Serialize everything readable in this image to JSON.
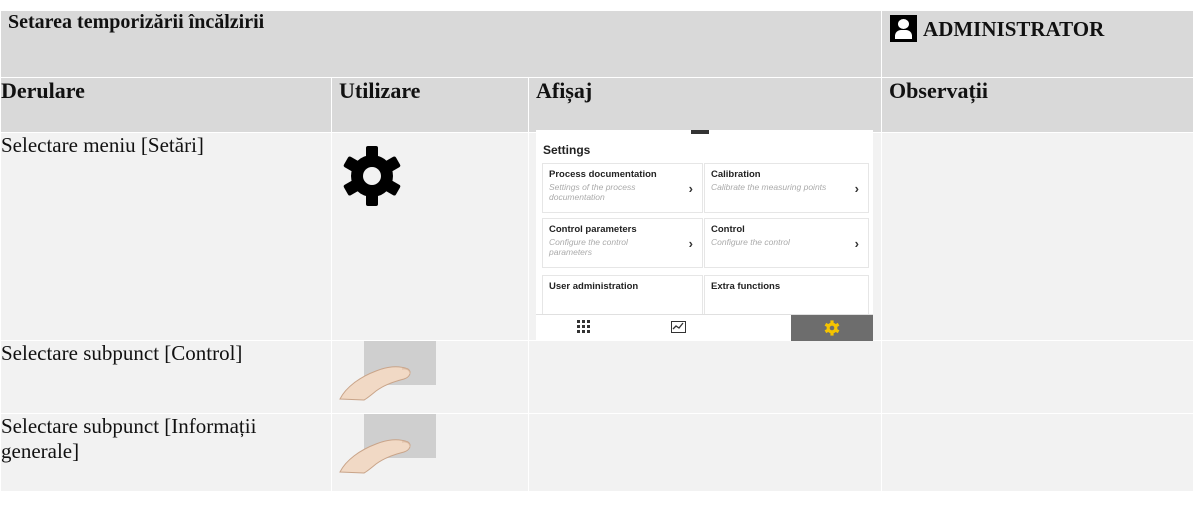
{
  "document": {
    "title": "Setarea temporizării încălzirii",
    "role": "ADMINISTRATOR",
    "columns": [
      "Derulare",
      "Utilizare",
      "Afișaj",
      "Observații"
    ],
    "rows": [
      {
        "step": "Selectare meniu [Setări]",
        "usage_icon": "gear-icon"
      },
      {
        "step": "Selectare subpunct [Control]",
        "usage_icon": "finger-tap-icon"
      },
      {
        "step": "Selectare subpunct [Informații generale]",
        "usage_icon": "finger-tap-icon"
      }
    ]
  },
  "screen": {
    "title": "Settings",
    "tiles": [
      {
        "name": "Process documentation",
        "desc": "Settings of the process documentation"
      },
      {
        "name": "Calibration",
        "desc": "Calibrate the measuring points"
      },
      {
        "name": "Control parameters",
        "desc": "Configure the control parameters"
      },
      {
        "name": "Control",
        "desc": "Configure the control"
      },
      {
        "name": "User administration",
        "desc": ""
      },
      {
        "name": "Extra functions",
        "desc": ""
      }
    ],
    "arrow": "›",
    "nav": [
      "apps-icon",
      "chart-icon",
      "settings-icon"
    ],
    "accent_color": "#f5c400"
  }
}
